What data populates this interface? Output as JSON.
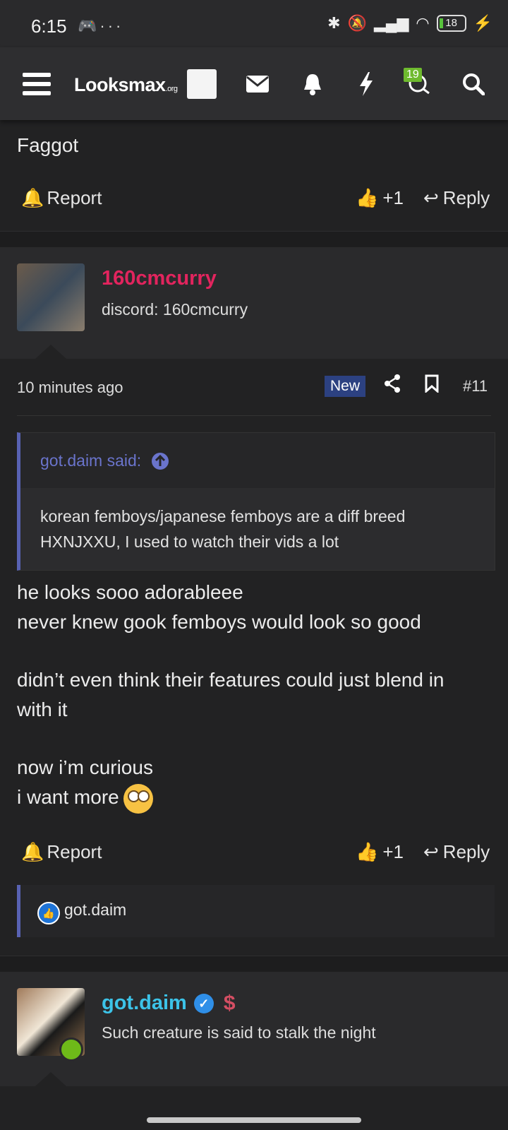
{
  "status_bar": {
    "time": "6:15",
    "left_icons": [
      "game-controller-icon",
      "more-dots-icon"
    ],
    "right_icons": [
      "bluetooth-icon",
      "mute-bell-icon",
      "signal-icon",
      "wifi-icon"
    ],
    "battery": "18"
  },
  "navbar": {
    "logo_main": "Looksmax",
    "logo_suffix": ".org",
    "messages_badge": "19",
    "icons": [
      "menu-icon",
      "user-avatar",
      "mail-icon",
      "bell-icon",
      "lightning-icon",
      "chat-icon",
      "search-icon"
    ]
  },
  "posts": [
    {
      "body_lines": [
        "Faggot"
      ],
      "actions": {
        "report": "Report",
        "like": "+1",
        "reply": "Reply"
      }
    },
    {
      "username": "160cmcurry",
      "user_title": "discord: 160cmcurry",
      "time": "10 minutes ago",
      "badge": "New",
      "post_number": "#11",
      "quote": {
        "author": "got.daim said:",
        "lines": [
          "korean femboys/japanese femboys are a diff breed",
          "HXNJXXU, I used to watch their vids a lot"
        ]
      },
      "body_lines": [
        "he looks sooo adorableee",
        "never knew gook femboys would look so good",
        "didn’t even think their features could just blend in",
        "with it",
        "now i’m curious",
        "i want more"
      ],
      "actions": {
        "report": "Report",
        "like": "+1",
        "reply": "Reply"
      },
      "reactions": {
        "user": "got.daim"
      }
    },
    {
      "username": "got.daim",
      "user_title": "Such creature is said to stalk the night"
    }
  ],
  "colors": {
    "accent": "#5862b3",
    "username_pink": "#e2245e",
    "username_cyan": "#3cc3e8",
    "new_badge": "#2c4181"
  }
}
